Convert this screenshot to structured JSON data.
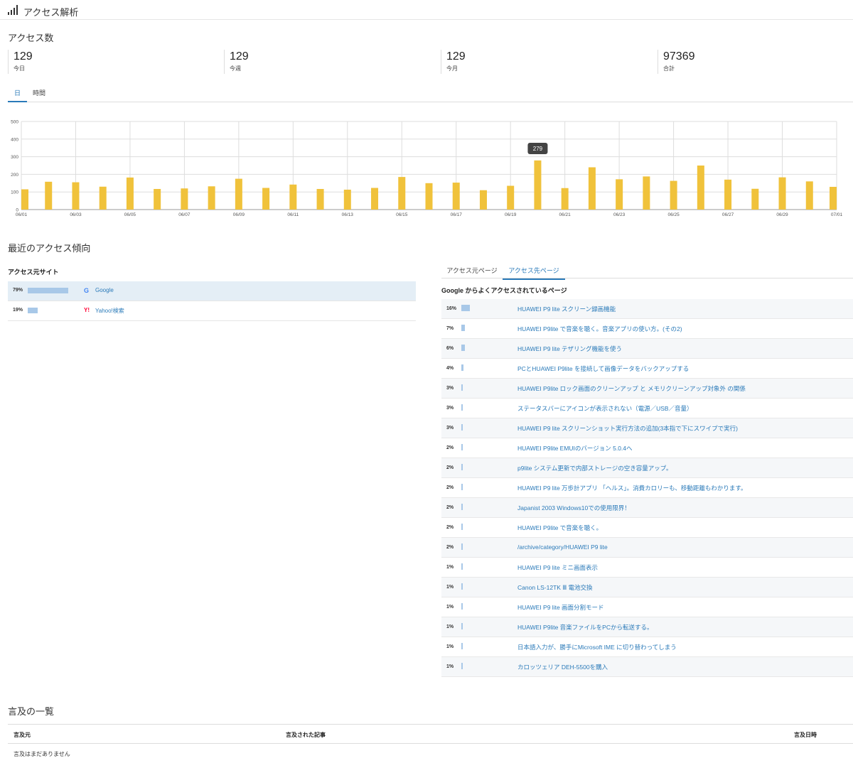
{
  "header": {
    "title": "アクセス解析",
    "icon": "signal-bars-icon"
  },
  "access_count": {
    "title": "アクセス数",
    "stats": [
      {
        "value": "129",
        "label": "今日"
      },
      {
        "value": "129",
        "label": "今週"
      },
      {
        "value": "129",
        "label": "今月"
      },
      {
        "value": "97369",
        "label": "合計"
      }
    ]
  },
  "period_tabs": [
    {
      "label": "日",
      "active": true
    },
    {
      "label": "時間",
      "active": false
    }
  ],
  "chart_data": {
    "type": "bar",
    "categories": [
      "06/01",
      "06/02",
      "06/03",
      "06/04",
      "06/05",
      "06/06",
      "06/07",
      "06/08",
      "06/09",
      "06/10",
      "06/11",
      "06/12",
      "06/13",
      "06/14",
      "06/15",
      "06/16",
      "06/17",
      "06/18",
      "06/19",
      "06/20",
      "06/21",
      "06/22",
      "06/23",
      "06/24",
      "06/25",
      "06/26",
      "06/27",
      "06/28",
      "06/29",
      "06/30",
      "07/01"
    ],
    "tick_labels": [
      "06/01",
      "06/03",
      "06/05",
      "06/07",
      "06/09",
      "06/11",
      "06/13",
      "06/15",
      "06/17",
      "06/19",
      "06/21",
      "06/23",
      "06/25",
      "06/27",
      "06/29",
      "07/01"
    ],
    "values": [
      115,
      158,
      155,
      130,
      182,
      117,
      120,
      132,
      175,
      123,
      142,
      117,
      113,
      123,
      185,
      150,
      153,
      110,
      135,
      279,
      122,
      240,
      172,
      188,
      163,
      250,
      170,
      118,
      183,
      160,
      129
    ],
    "ylim": [
      0,
      500
    ],
    "yticks": [
      0,
      100,
      200,
      300,
      400,
      500
    ],
    "grid": true,
    "bar_color": "#f0c23b",
    "tooltip": {
      "category": "06/20",
      "value": "279"
    }
  },
  "recent": {
    "title": "最近のアクセス傾向",
    "sources_title": "アクセス元サイト",
    "sources": [
      {
        "pct": "79%",
        "fraction": 0.79,
        "icon": "google-icon",
        "icon_text": "G",
        "icon_color": "#4285f4",
        "name": "Google",
        "highlight": true
      },
      {
        "pct": "19%",
        "fraction": 0.19,
        "icon": "yahoo-icon",
        "icon_text": "Y!",
        "icon_color": "#ff0033",
        "name": "Yahoo!検索",
        "highlight": false
      }
    ],
    "tabs": [
      {
        "label": "アクセス元ページ",
        "active": false
      },
      {
        "label": "アクセス先ページ",
        "active": true
      }
    ],
    "pages_title": "Google からよくアクセスされているページ",
    "pages": [
      {
        "pct": "16%",
        "fraction": 0.16,
        "title": "HUAWEI P9 lite スクリーン録画機能"
      },
      {
        "pct": "7%",
        "fraction": 0.07,
        "title": "HUAWEI P9lite で音楽を聴く。音楽アプリの使い方。(その2)"
      },
      {
        "pct": "6%",
        "fraction": 0.06,
        "title": "HUAWEI P9 lite テザリング機能を使う"
      },
      {
        "pct": "4%",
        "fraction": 0.04,
        "title": "PCとHUAWEI P9lite を接続して画像データをバックアップする"
      },
      {
        "pct": "3%",
        "fraction": 0.03,
        "title": "HUAWEI P9lite ロック画面のクリーンアップ と メモリクリーンアップ対象外 の関係"
      },
      {
        "pct": "3%",
        "fraction": 0.03,
        "title": "ステータスバーにアイコンが表示されない（電源／USB／音量）"
      },
      {
        "pct": "3%",
        "fraction": 0.03,
        "title": "HUAWEI P9 lite スクリーンショット実行方法の追加(3本指で下にスワイプで実行)"
      },
      {
        "pct": "2%",
        "fraction": 0.02,
        "title": "HUAWEI P9lite EMUIのバージョン 5.0.4へ"
      },
      {
        "pct": "2%",
        "fraction": 0.02,
        "title": "p9lite システム更新で内部ストレージの空き容量アップ。"
      },
      {
        "pct": "2%",
        "fraction": 0.02,
        "title": "HUAWEI P9 lite 万歩計アプリ 「ヘルス」。消費カロリーも、移動距離もわかります。"
      },
      {
        "pct": "2%",
        "fraction": 0.02,
        "title": "Japanist 2003 Windows10での使用限界！"
      },
      {
        "pct": "2%",
        "fraction": 0.02,
        "title": "HUAWEI P9lite で音楽を聴く。"
      },
      {
        "pct": "2%",
        "fraction": 0.02,
        "title": "/archive/category/HUAWEI P9 lite"
      },
      {
        "pct": "1%",
        "fraction": 0.01,
        "title": "HUAWEI P9 lite ミニ画面表示"
      },
      {
        "pct": "1%",
        "fraction": 0.01,
        "title": "Canon LS-12TK Ⅲ 電池交換"
      },
      {
        "pct": "1%",
        "fraction": 0.01,
        "title": "HUAWEI P9 lite 画面分割モード"
      },
      {
        "pct": "1%",
        "fraction": 0.01,
        "title": "HUAWEI P9lite 音楽ファイルをPCから転送する。"
      },
      {
        "pct": "1%",
        "fraction": 0.01,
        "title": "日本語入力が、勝手にMicrosoft IME に切り替わってしまう"
      },
      {
        "pct": "1%",
        "fraction": 0.01,
        "title": "カロッツェリア DEH-5500を購入"
      }
    ]
  },
  "mentions": {
    "title": "言及の一覧",
    "col_source": "言及元",
    "col_article": "言及された記事",
    "col_date": "言及日時",
    "empty": "言及はまだありません"
  }
}
